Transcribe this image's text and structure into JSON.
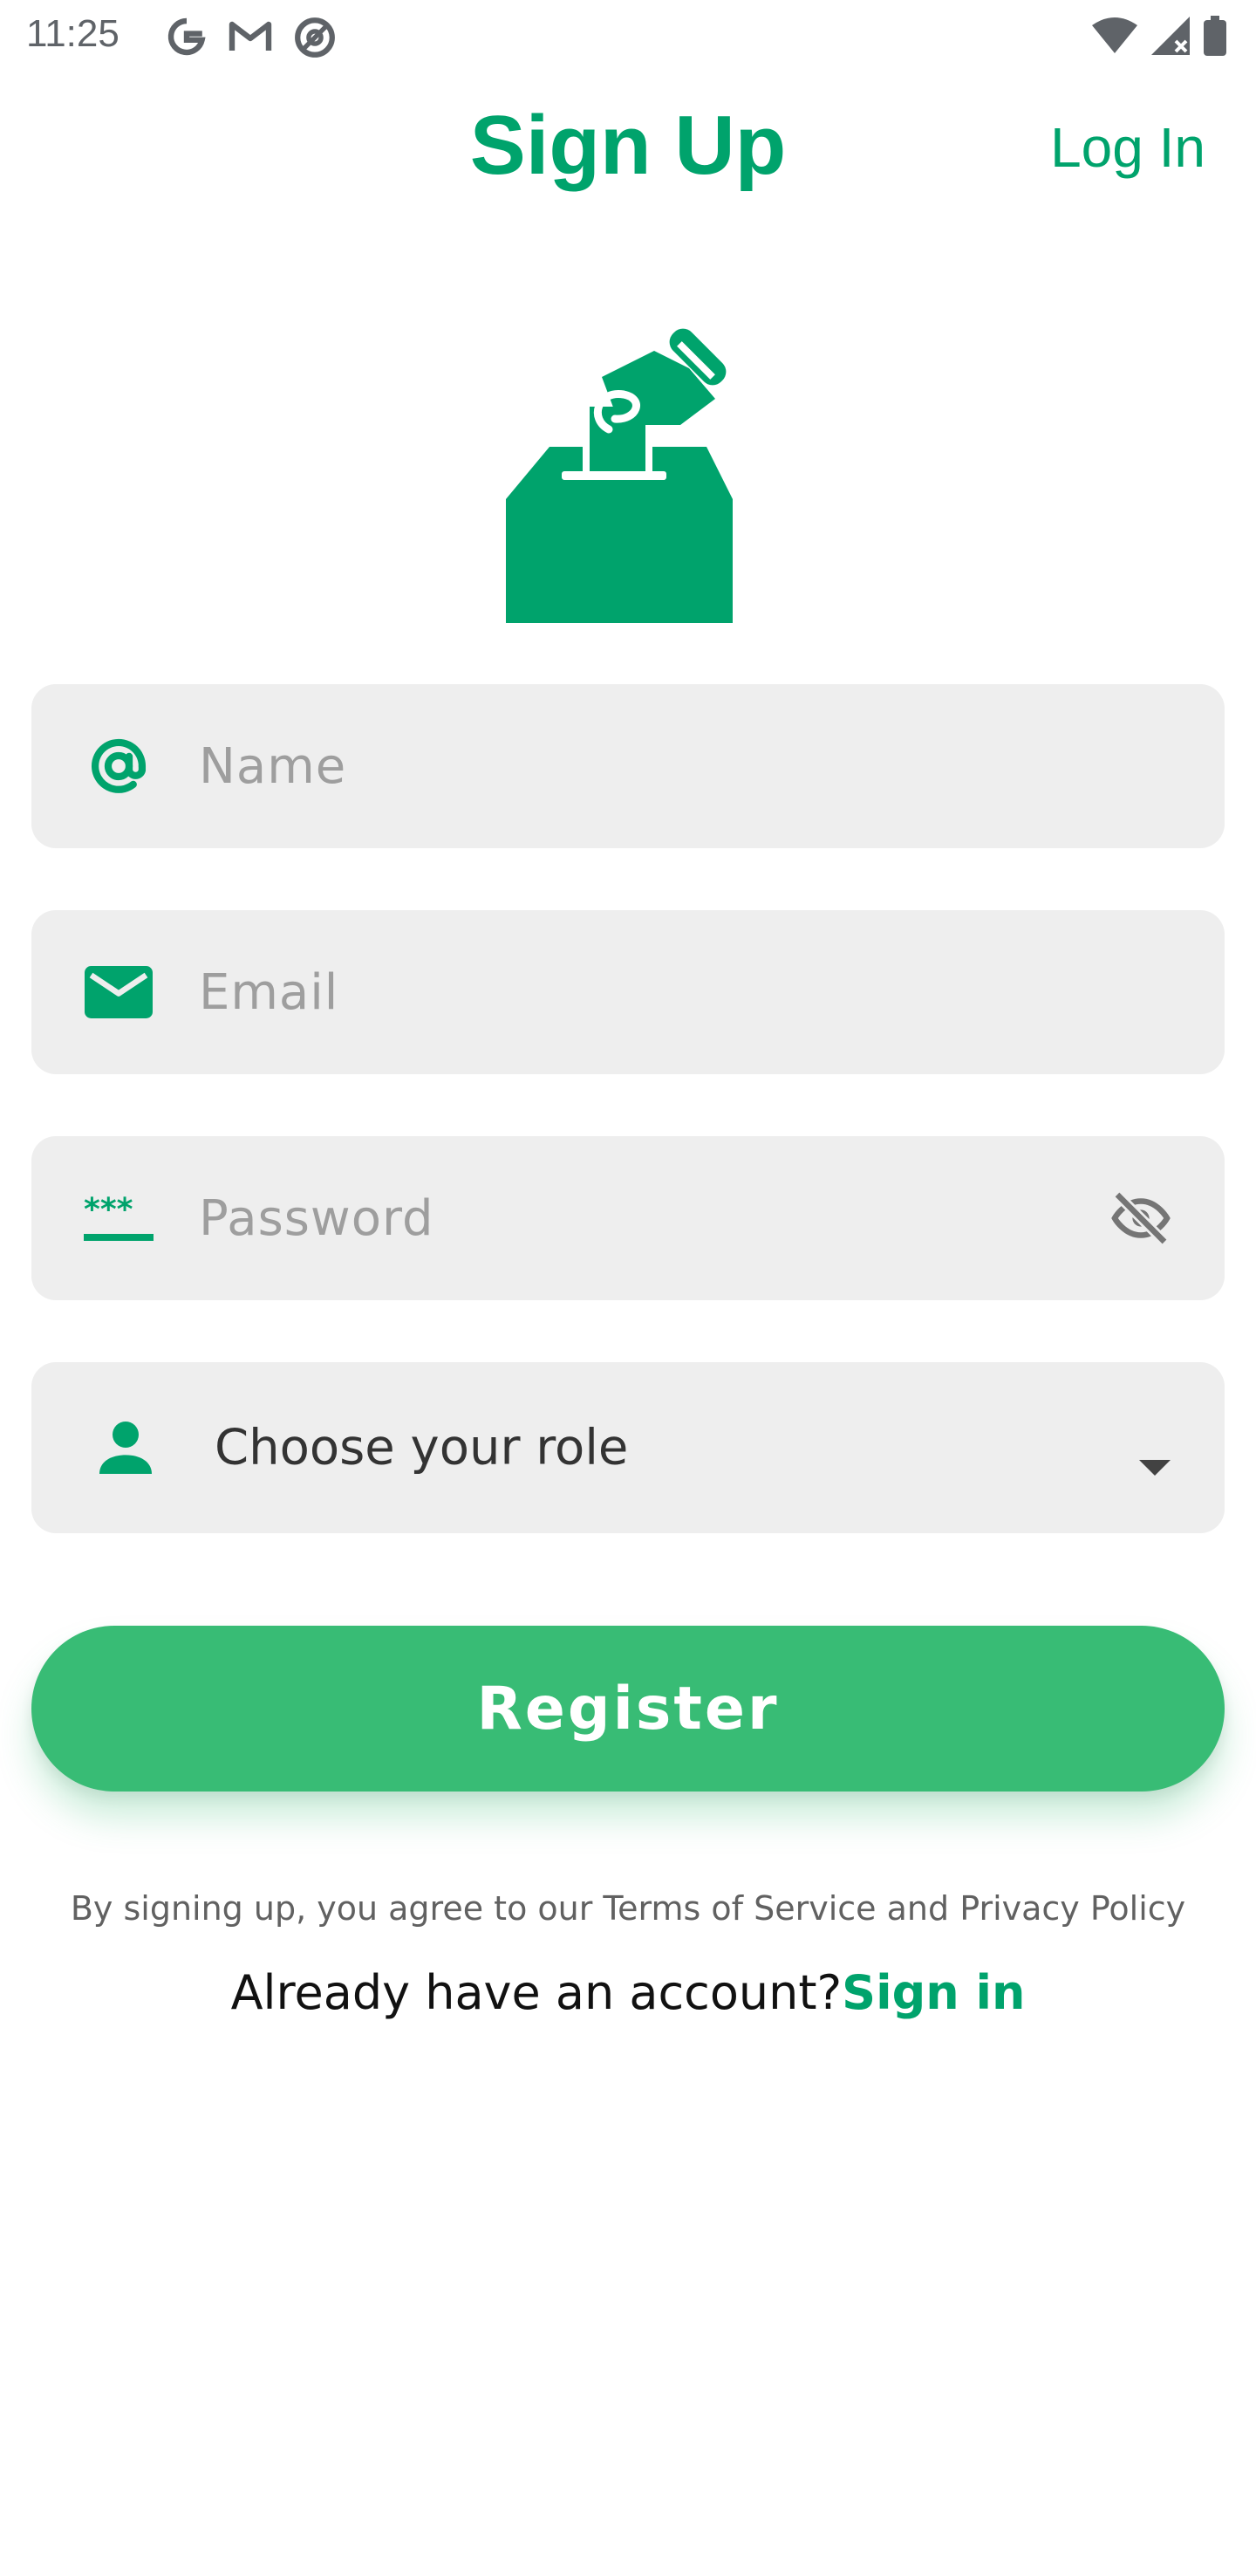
{
  "status_bar": {
    "time": "11:25",
    "left_icons": [
      "google-icon",
      "gmail-icon",
      "at-sign-icon"
    ],
    "right_icons": [
      "wifi-icon",
      "signal-icon",
      "battery-icon"
    ]
  },
  "header": {
    "title": "Sign Up",
    "login_label": "Log In"
  },
  "logo": {
    "icon": "ballot-box-icon"
  },
  "form": {
    "name": {
      "placeholder": "Name",
      "value": "",
      "icon": "at-sign-icon"
    },
    "email": {
      "placeholder": "Email",
      "value": "",
      "icon": "mail-icon"
    },
    "password": {
      "placeholder": "Password",
      "value": "",
      "icon": "password-icon",
      "toggle_icon": "eye-off-icon"
    },
    "role": {
      "selected": "Choose your role",
      "icon": "person-icon"
    }
  },
  "actions": {
    "register_label": "Register"
  },
  "footer": {
    "terms": "By signing up, you agree to our Terms of Service and Privacy Policy",
    "signin_prompt": "Already have an account?",
    "signin_label": "Sign in"
  },
  "colors": {
    "accent": "#00a36c",
    "button": "#38bc75",
    "field_bg": "#eeeeee"
  }
}
